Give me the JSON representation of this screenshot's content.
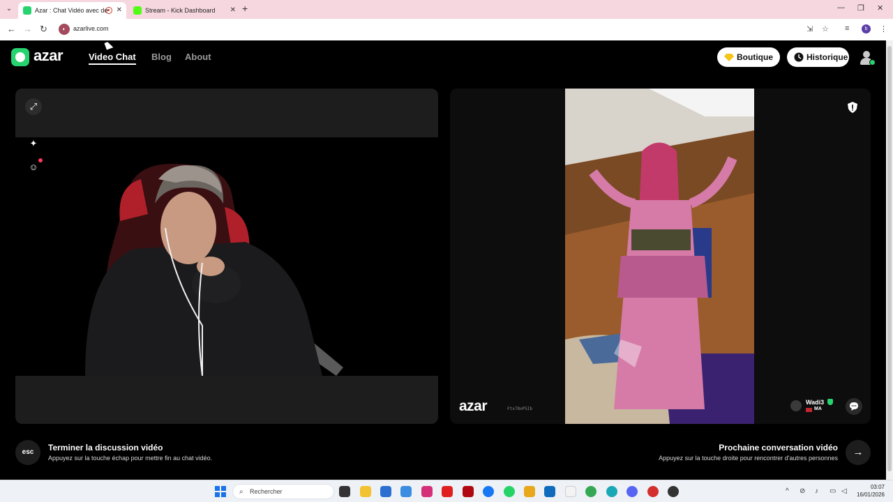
{
  "browser": {
    "tabs": [
      {
        "title": "Azar : Chat Vidéo avec de",
        "active": true,
        "favicon_color": "#27d36f"
      },
      {
        "title": "Stream - Kick Dashboard",
        "active": false,
        "favicon_color": "#53fc18"
      }
    ],
    "url": "azarlive.com",
    "profile_initial": "b"
  },
  "header": {
    "logo_text": "azar",
    "nav": [
      {
        "label": "Video Chat",
        "active": true
      },
      {
        "label": "Blog",
        "active": false
      },
      {
        "label": "About",
        "active": false
      }
    ],
    "boutique_label": "Boutique",
    "historique_label": "Historique"
  },
  "remote": {
    "logo_text": "azar",
    "code": "Ftx78xP5Ib",
    "user_name": "Wadi3",
    "country": "MA"
  },
  "footer": {
    "esc_label": "esc",
    "end_title": "Terminer la discussion vidéo",
    "end_desc": "Appuyez sur la touche échap pour mettre fin au chat vidéo.",
    "next_title": "Prochaine conversation vidéo",
    "next_desc": "Appuyez sur la touche droite pour rencontrer d'autres personnes"
  },
  "taskbar": {
    "search_placeholder": "Rechercher",
    "time": "03:07",
    "date": "16/01/2026"
  },
  "colors": {
    "accent": "#27d36f",
    "tab_bar": "#f6d7df",
    "panel": "#1d1d1d"
  }
}
